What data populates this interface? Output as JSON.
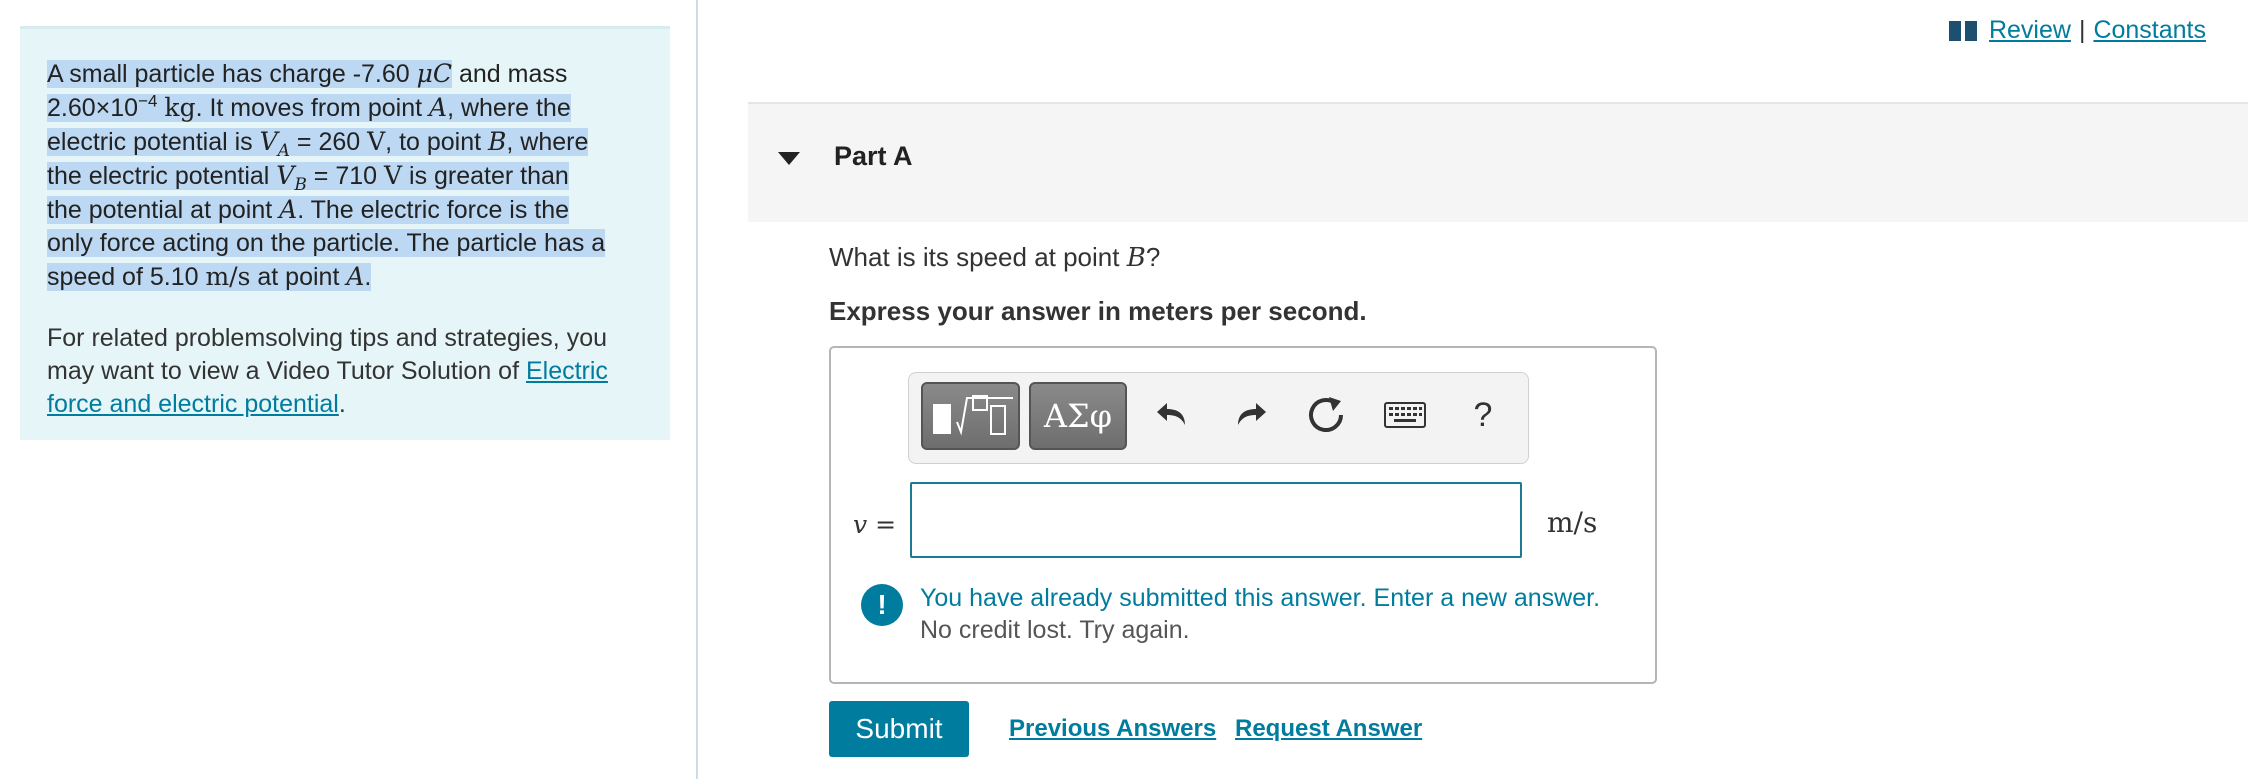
{
  "top_links": {
    "review": "Review",
    "separator": "|",
    "constants": "Constants"
  },
  "problem": {
    "t1": "A small particle has charge -7.60 ",
    "u1": "μC",
    "t2": " and mass",
    "t3": "2.60×10",
    "exp1": "−4",
    "u2": "kg",
    "t4": ". It moves from point ",
    "pA": "A",
    "t5": ", where the",
    "t6": "electric potential is ",
    "vA": "V",
    "vA_sub": "A",
    "t7": " = 260 ",
    "uV1": "V",
    "t8": ", to point ",
    "pB": "B",
    "t9": ", where",
    "t10": "the electric potential ",
    "vB": "V",
    "vB_sub": "B",
    "t11": " = 710 ",
    "uV2": "V",
    "t12": " is greater than",
    "t13": "the potential at point ",
    "pA2": "A",
    "t14": ". The electric force is the",
    "t15": "only force acting on the particle. The particle has a",
    "t16": "speed of 5.10 ",
    "u3": "m/s",
    "t17": " at point ",
    "pA3": "A",
    "t18": "."
  },
  "related": {
    "text1": "For related problemsolving tips and strategies, you may want to view a Video Tutor Solution of ",
    "link": "Electric force and electric potential",
    "text2": "."
  },
  "part": {
    "title": "Part A",
    "question_prefix": "What is its speed at point ",
    "question_var": "B",
    "question_suffix": "?",
    "instruction": "Express your answer in meters per second."
  },
  "toolbar": {
    "symbols_label": "ΑΣφ",
    "help_label": "?",
    "icons": [
      "templates-icon",
      "undo-icon",
      "redo-icon",
      "reset-icon",
      "keyboard-icon"
    ]
  },
  "answer": {
    "var_label": "v =",
    "value": "",
    "unit": "m/s"
  },
  "feedback": {
    "message": "You have already submitted this answer. Enter a new answer.",
    "sub_message": "No credit lost. Try again."
  },
  "actions": {
    "submit": "Submit",
    "previous_answers": "Previous Answers",
    "request_answer": "Request Answer"
  },
  "colors": {
    "accent": "#007c9e",
    "panel_bg": "#e6f5f7",
    "highlight": "#bcd8f2"
  }
}
